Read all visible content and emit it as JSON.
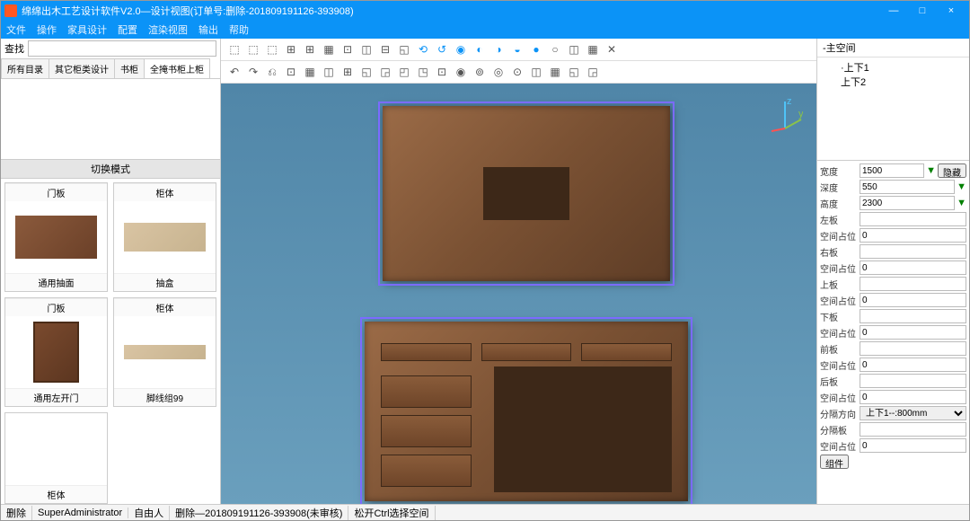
{
  "window": {
    "title": "绵绵出木工艺设计软件V2.0—设计视图(订单号:删除-201809191126-393908)",
    "min": "—",
    "max": "□",
    "close": "×"
  },
  "menu": [
    "文件",
    "操作",
    "家具设计",
    "配置",
    "渲染视图",
    "输出",
    "帮助"
  ],
  "search": {
    "label": "查找",
    "value": ""
  },
  "lefttabs": [
    "所有目录",
    "其它柜类设计",
    "书柜",
    "全掩书柜上柜"
  ],
  "switch_header": "切换模式",
  "catalog": [
    {
      "top": "门板",
      "bottom": "通用抽面"
    },
    {
      "top": "柜体",
      "bottom": "抽盒"
    },
    {
      "top": "门板",
      "bottom": "通用左开门"
    },
    {
      "top": "柜体",
      "bottom": "脚线组99"
    },
    {
      "top": "",
      "bottom": "柜体"
    }
  ],
  "tree": {
    "header": "-主空间",
    "items": [
      "·上下1",
      "上下2"
    ]
  },
  "props": {
    "width": {
      "label": "宽度",
      "value": "1500"
    },
    "depth": {
      "label": "深度",
      "value": "550"
    },
    "height": {
      "label": "高度",
      "value": "2300"
    },
    "hide_btn": "隐藏",
    "left_panel": {
      "label": "左板",
      "value": ""
    },
    "space1": {
      "label": "空间占位",
      "value": "0"
    },
    "right_panel": {
      "label": "右板",
      "value": ""
    },
    "space2": {
      "label": "空间占位",
      "value": "0"
    },
    "top_panel": {
      "label": "上板",
      "value": ""
    },
    "space3": {
      "label": "空间占位",
      "value": "0"
    },
    "bottom_panel": {
      "label": "下板",
      "value": ""
    },
    "space4": {
      "label": "空间占位",
      "value": "0"
    },
    "front_panel": {
      "label": "前板",
      "value": ""
    },
    "space5": {
      "label": "空间占位",
      "value": "0"
    },
    "back_panel": {
      "label": "后板",
      "value": ""
    },
    "space6": {
      "label": "空间占位",
      "value": "0"
    },
    "divide_dir": {
      "label": "分隔方向",
      "value": "上下1--:800mm"
    },
    "divider": {
      "label": "分隔板",
      "value": ""
    },
    "space7": {
      "label": "空间占位",
      "value": "0"
    },
    "component_btn": "组件"
  },
  "status": [
    "删除",
    "SuperAdministrator",
    "自由人",
    "删除—201809191126-393908(未审核)",
    "松开Ctrl选择空间"
  ],
  "toolbar_icons": [
    "⬚",
    "⬚",
    "⬚",
    "⊞",
    "⊞",
    "▦",
    "⊡",
    "◫",
    "⊟",
    "◱",
    "⟲",
    "↺",
    "◉",
    "◐",
    "◑",
    "◒",
    "●",
    "○",
    "◫",
    "▦",
    "✕"
  ],
  "toolbar_icons2": [
    "↶",
    "↷",
    "⎌",
    "⊡",
    "▦",
    "◫",
    "⊞",
    "◱",
    "◲",
    "◰",
    "◳",
    "⊡",
    "◉",
    "⊚",
    "◎",
    "⊙",
    "◫",
    "▦",
    "◱",
    "◲"
  ]
}
